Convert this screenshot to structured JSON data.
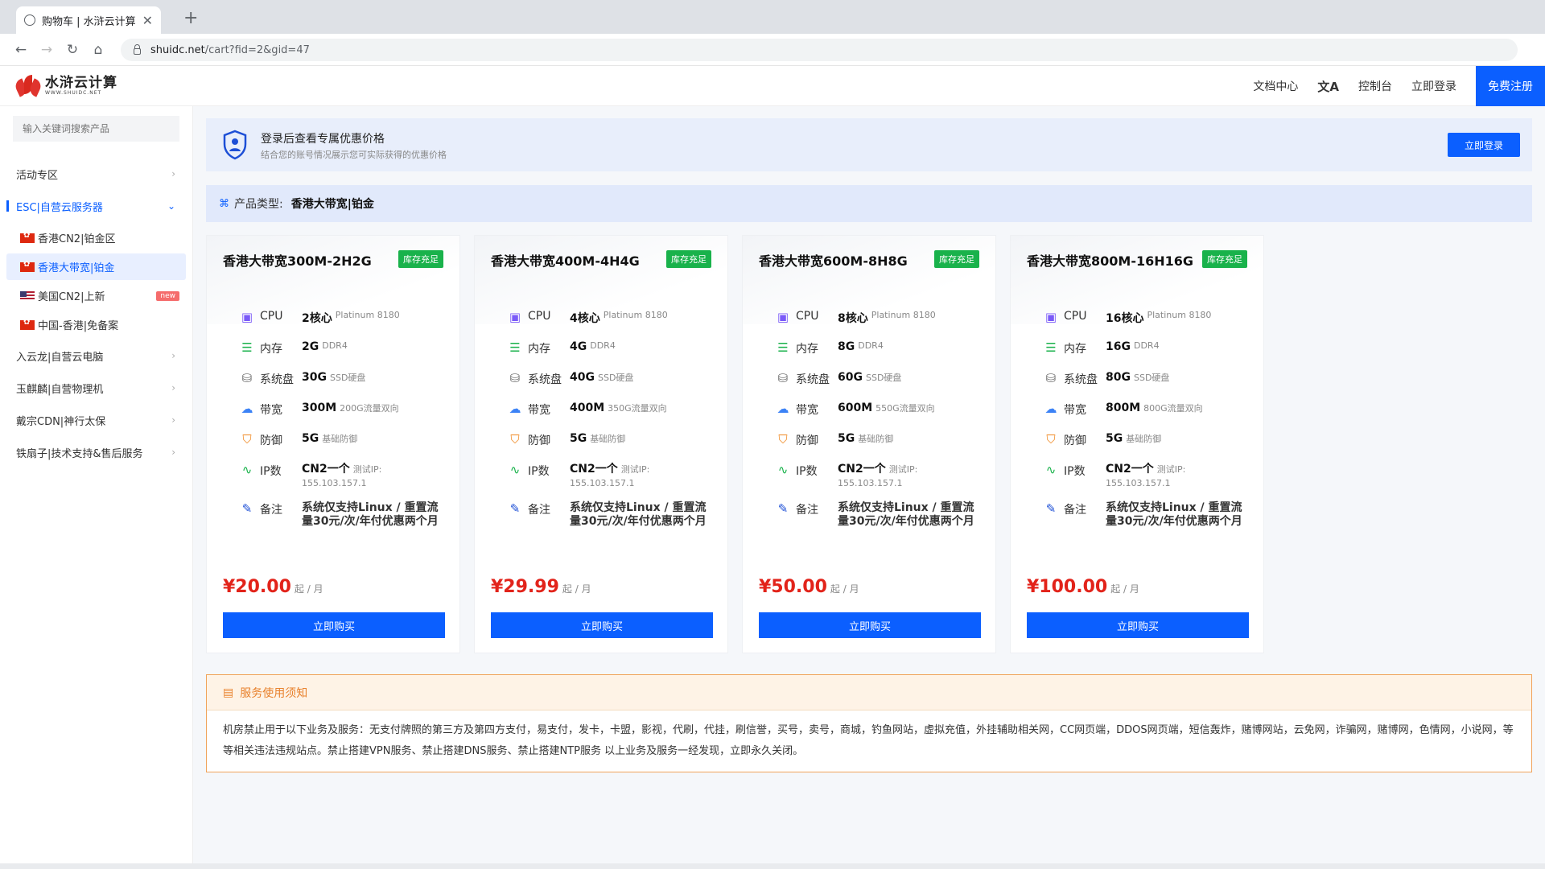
{
  "browser": {
    "tab_title": "购物车 | 水浒云计算",
    "url_domain": "shuidc.net",
    "url_path": "/cart?fid=2&gid=47"
  },
  "header": {
    "logo_cn": "水浒云计算",
    "logo_en": "WWW.SHUIDC.NET",
    "nav": [
      "文档中心",
      "控制台",
      "立即登录"
    ],
    "translate_icon": "translate-icon",
    "register": "免费注册"
  },
  "sidebar": {
    "search_placeholder": "输入关键词搜索产品",
    "groups": [
      {
        "label": "活动专区",
        "expanded": false
      },
      {
        "label": "ESC|自营云服务器",
        "expanded": true
      }
    ],
    "subitems": [
      {
        "label": "香港CN2|铂金区",
        "flag": "hk"
      },
      {
        "label": "香港大带宽|铂金",
        "flag": "hk",
        "active": true
      },
      {
        "label": "美国CN2|上新",
        "flag": "us",
        "badge": "new"
      },
      {
        "label": "中国-香港|免备案",
        "flag": "hk"
      }
    ],
    "more_groups": [
      "入云龙|自营云电脑",
      "玉麒麟|自营物理机",
      "戴宗CDN|神行太保",
      "铁扇子|技术支持&售后服务"
    ]
  },
  "banner": {
    "title": "登录后查看专属优惠价格",
    "subtitle": "结合您的账号情况展示您可实际获得的优惠价格",
    "button": "立即登录"
  },
  "product_type": {
    "label": "产品类型:",
    "value": "香港大带宽|铂金"
  },
  "spec_labels": {
    "cpu": "CPU",
    "mem": "内存",
    "disk": "系统盘",
    "bw": "带宽",
    "def": "防御",
    "ip": "IP数",
    "note": "备注"
  },
  "cards": [
    {
      "title": "香港大带宽300M-2H2G",
      "stock": "库存充足",
      "cpu": "2核心",
      "cpu_note": "Platinum 8180",
      "mem": "2G",
      "mem_note": "DDR4",
      "disk": "30G",
      "disk_note": "SSD硬盘",
      "bw": "300M",
      "bw_note": "200G流量双向",
      "def": "5G",
      "def_note": "基础防御",
      "ip": "CN2一个",
      "ip_note": "测试IP:",
      "ip_addr": "155.103.157.1",
      "note": "系统仅支持Linux / 重置流量30元/次/年付优惠两个月",
      "price": "¥20.00",
      "unit": "起 / 月",
      "buy": "立即购买"
    },
    {
      "title": "香港大带宽400M-4H4G",
      "stock": "库存充足",
      "cpu": "4核心",
      "cpu_note": "Platinum 8180",
      "mem": "4G",
      "mem_note": "DDR4",
      "disk": "40G",
      "disk_note": "SSD硬盘",
      "bw": "400M",
      "bw_note": "350G流量双向",
      "def": "5G",
      "def_note": "基础防御",
      "ip": "CN2一个",
      "ip_note": "测试IP:",
      "ip_addr": "155.103.157.1",
      "note": "系统仅支持Linux / 重置流量30元/次/年付优惠两个月",
      "price": "¥29.99",
      "unit": "起 / 月",
      "buy": "立即购买"
    },
    {
      "title": "香港大带宽600M-8H8G",
      "stock": "库存充足",
      "cpu": "8核心",
      "cpu_note": "Platinum 8180",
      "mem": "8G",
      "mem_note": "DDR4",
      "disk": "60G",
      "disk_note": "SSD硬盘",
      "bw": "600M",
      "bw_note": "550G流量双向",
      "def": "5G",
      "def_note": "基础防御",
      "ip": "CN2一个",
      "ip_note": "测试IP:",
      "ip_addr": "155.103.157.1",
      "note": "系统仅支持Linux / 重置流量30元/次/年付优惠两个月",
      "price": "¥50.00",
      "unit": "起 / 月",
      "buy": "立即购买"
    },
    {
      "title": "香港大带宽800M-16H16G",
      "stock": "库存充足",
      "cpu": "16核心",
      "cpu_note": "Platinum 8180",
      "mem": "16G",
      "mem_note": "DDR4",
      "disk": "80G",
      "disk_note": "SSD硬盘",
      "bw": "800M",
      "bw_note": "800G流量双向",
      "def": "5G",
      "def_note": "基础防御",
      "ip": "CN2一个",
      "ip_note": "测试IP:",
      "ip_addr": "155.103.157.1",
      "note": "系统仅支持Linux / 重置流量30元/次/年付优惠两个月",
      "price": "¥100.00",
      "unit": "起 / 月",
      "buy": "立即购买"
    }
  ],
  "notice": {
    "title": "服务使用须知",
    "body": "机房禁止用于以下业务及服务：无支付牌照的第三方及第四方支付，易支付，发卡，卡盟，影视，代刷，代挂，刷信誉，买号，卖号，商城，钓鱼网站，虚拟充值，外挂辅助相关网，CC网页端，DDOS网页端，短信轰炸，赌博网站，云免网，诈骗网，赌博网，色情网，小说网，等等相关违法违规站点。禁止搭建VPN服务、禁止搭建DNS服务、禁止搭建NTP服务 以上业务及服务一经发现，立即永久关闭。"
  },
  "colors": {
    "accent": "#0b5fff",
    "price": "#e2231a",
    "stock": "#19b24b",
    "notice": "#e8812c"
  }
}
